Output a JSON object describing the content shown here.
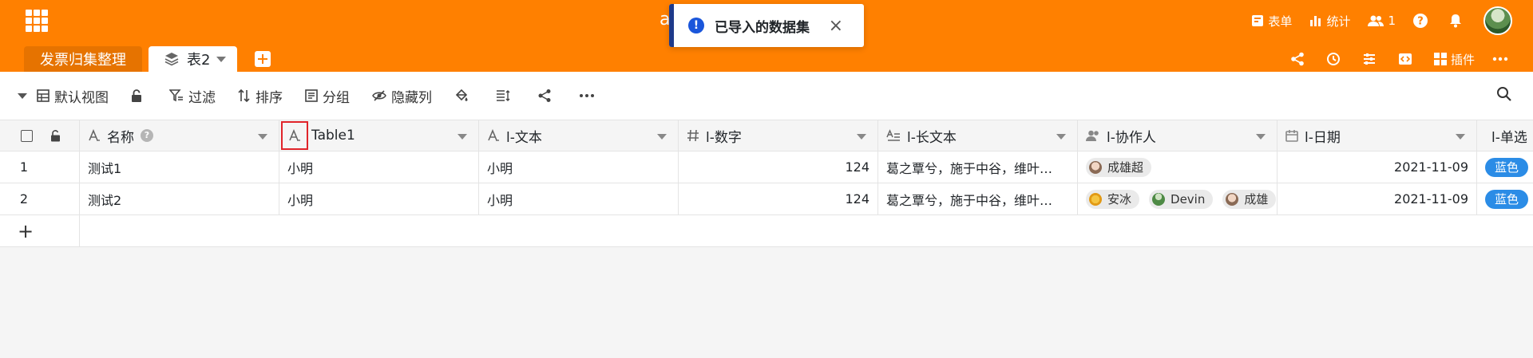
{
  "header": {
    "top_right": {
      "form_label": "表单",
      "stats_label": "统计",
      "members_count": "1"
    },
    "tabs": {
      "base_name": "发票归集整理",
      "active_table": "表2"
    },
    "sub_right": {
      "plugins_label": "插件"
    }
  },
  "toast": {
    "message": "已导入的数据集",
    "close": "×",
    "ghost_char": "a"
  },
  "toolbar": {
    "view_label": "默认视图",
    "filter_label": "过滤",
    "sort_label": "排序",
    "group_label": "分组",
    "hide_label": "隐藏列"
  },
  "table": {
    "columns": [
      "名称",
      "Table1",
      "l-文本",
      "l-数字",
      "l-长文本",
      "l-协作人",
      "l-日期",
      "l-单选"
    ],
    "rows": [
      {
        "index": "1",
        "name": "测试1",
        "table1": "小明",
        "text": "小明",
        "number": "124",
        "long_text": "葛之覃兮，施于中谷，维叶…",
        "collaborators": [
          "成雄超"
        ],
        "date": "2021-11-09",
        "single": "蓝色"
      },
      {
        "index": "2",
        "name": "测试2",
        "table1": "小明",
        "text": "小明",
        "number": "124",
        "long_text": "葛之覃兮，施于中谷，维叶…",
        "collaborators": [
          "安冰",
          "Devin",
          "成雄"
        ],
        "date": "2021-11-09",
        "single": "蓝色"
      }
    ],
    "add_row": "+"
  }
}
